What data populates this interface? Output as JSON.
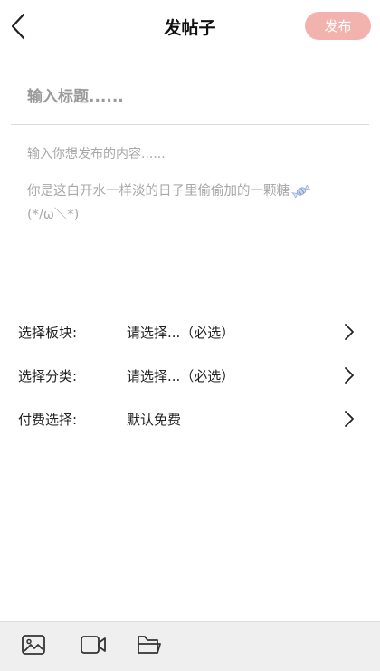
{
  "header": {
    "title": "发帖子",
    "publish_label": "发布",
    "back_icon": "chevron-left-icon"
  },
  "colors": {
    "publish_bg": "#f2b3ae",
    "placeholder": "#9a9a9a",
    "toolbar_bg": "#efefef"
  },
  "form": {
    "title_placeholder": "输入标题......",
    "content_placeholder": "输入你想发布的内容......",
    "hint": "你是这白开水一样淡的日子里偷偷加的一颗糖",
    "hint_emoticon": "(*/ω＼*)",
    "hint_icon": "candy-icon"
  },
  "options": [
    {
      "label": "选择板块:",
      "value": "请选择...（必选）",
      "icon": "chevron-right-icon"
    },
    {
      "label": "选择分类:",
      "value": "请选择...（必选）",
      "icon": "chevron-right-icon"
    },
    {
      "label": "付费选择:",
      "value": "默认免费",
      "icon": "chevron-right-icon"
    }
  ],
  "toolbar": {
    "icons": [
      "image-icon",
      "video-icon",
      "folder-icon"
    ]
  }
}
